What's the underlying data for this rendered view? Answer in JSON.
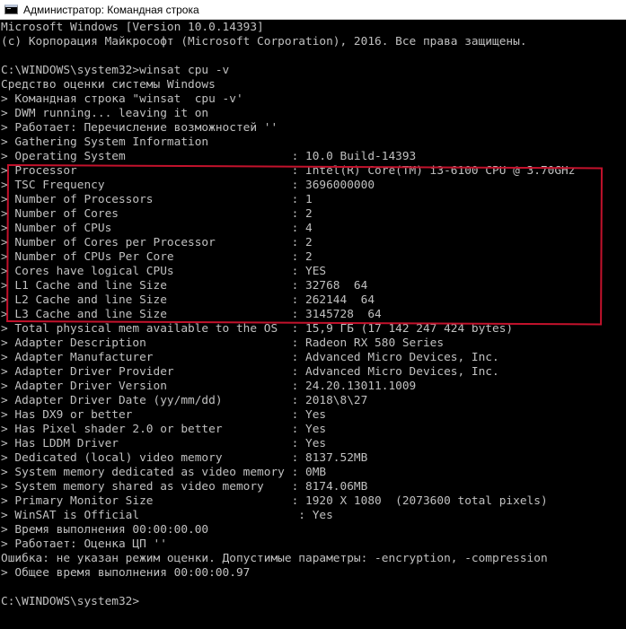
{
  "window": {
    "title": "Администратор: Командная строка"
  },
  "console": {
    "lines": [
      "Microsoft Windows [Version 10.0.14393]",
      "(c) Корпорация Майкрософт (Microsoft Corporation), 2016. Все права защищены.",
      "",
      "C:\\WINDOWS\\system32>winsat cpu -v",
      "Средство оценки системы Windows",
      "> Командная строка \"winsat  cpu -v'",
      "> DWM running... leaving it on",
      "> Работает: Перечисление возможностей ''",
      "> Gathering System Information",
      "> Operating System                        : 10.0 Build-14393",
      "> Processor                               : Intel(R) Core(TM) i3-6100 CPU @ 3.70GHz",
      "> TSC Frequency                           : 3696000000",
      "> Number of Processors                    : 1",
      "> Number of Cores                         : 2",
      "> Number of CPUs                          : 4",
      "> Number of Cores per Processor           : 2",
      "> Number of CPUs Per Core                 : 2",
      "> Cores have logical CPUs                 : YES",
      "> L1 Cache and line Size                  : 32768  64",
      "> L2 Cache and line Size                  : 262144  64",
      "> L3 Cache and line Size                  : 3145728  64",
      "> Total physical mem available to the OS  : 15,9 ГБ (17 142 247 424 bytes)",
      "> Adapter Description                     : Radeon RX 580 Series",
      "> Adapter Manufacturer                    : Advanced Micro Devices, Inc.",
      "> Adapter Driver Provider                 : Advanced Micro Devices, Inc.",
      "> Adapter Driver Version                  : 24.20.13011.1009",
      "> Adapter Driver Date (yy/mm/dd)          : 2018\\8\\27",
      "> Has DX9 or better                       : Yes",
      "> Has Pixel shader 2.0 or better          : Yes",
      "> Has LDDM Driver                         : Yes",
      "> Dedicated (local) video memory          : 8137.52MB",
      "> System memory dedicated as video memory : 0MB",
      "> System memory shared as video memory    : 8174.06MB",
      "> Primary Monitor Size                    : 1920 X 1080  (2073600 total pixels)",
      "> WinSAT is Official                       : Yes",
      "> Время выполнения 00:00:00.00",
      "> Работает: Оценка ЦП ''",
      "Ошибка: не указан режим оценки. Допустимые параметры: -encryption, -compression",
      "> Общее время выполнения 00:00:00.97",
      "",
      "C:\\WINDOWS\\system32>"
    ]
  },
  "colors": {
    "background": "#000000",
    "text": "#c0c0c0",
    "highlight_box": "#c3122c"
  },
  "icons": {
    "title": "console-window-icon"
  }
}
